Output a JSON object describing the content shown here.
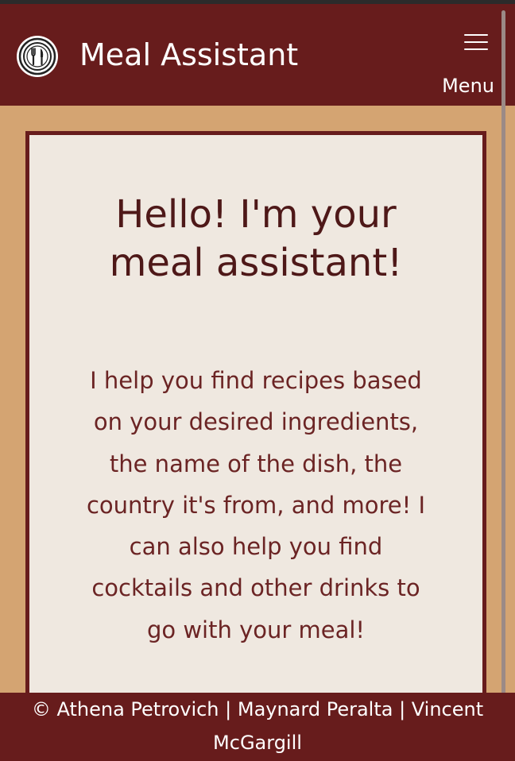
{
  "app": {
    "title": "Meal Assistant"
  },
  "navbar": {
    "logo_icon": "fork-knife-plate-icon",
    "menu_icon": "hamburger-icon",
    "menu_label": "Menu"
  },
  "hero": {
    "title": "Hello! I'm your meal assistant!",
    "body": "I help you find recipes based on your desired ingredients, the name of the dish, the country it's from, and more! I can also help you find cocktails and other drinks to go with your meal!"
  },
  "footer": {
    "credits": "© Athena Petrovich | Maynard Peralta | Vincent McGargill"
  },
  "colors": {
    "primary": "#671c1c",
    "background": "#d4a472",
    "card": "#efe8e0",
    "title_text": "#4e1818",
    "body_text": "#6b2424"
  }
}
